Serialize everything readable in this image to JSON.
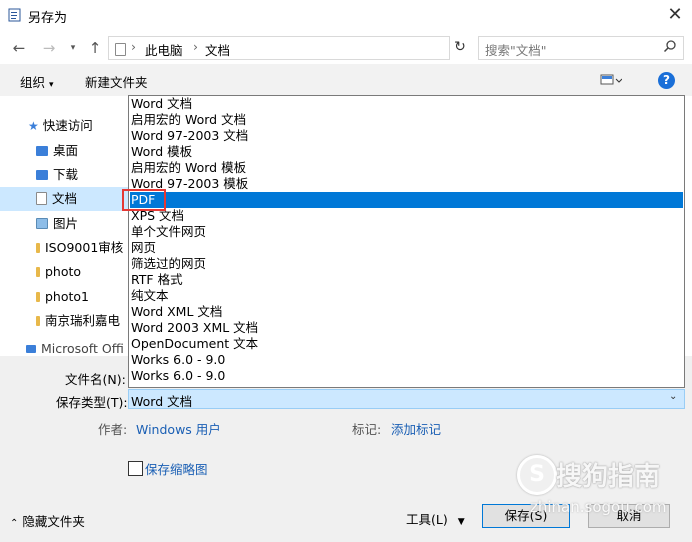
{
  "window": {
    "title": "另存为"
  },
  "nav": {
    "path": [
      "此电脑",
      "文档"
    ],
    "search_placeholder": "搜索\"文档\""
  },
  "toolbar": {
    "organize": "组织",
    "new_folder": "新建文件夹"
  },
  "sidebar": {
    "quick_access": "快速访问",
    "items": [
      "桌面",
      "下载",
      "文档",
      "图片",
      "ISO9001审核",
      "photo",
      "photo1",
      "南京瑞利嘉电",
      "Microsoft Offi"
    ]
  },
  "dropdown": {
    "options": [
      "Word 文档",
      "启用宏的 Word 文档",
      "Word 97-2003 文档",
      "Word 模板",
      "启用宏的 Word 模板",
      "Word 97-2003 模板",
      "PDF",
      "XPS 文档",
      "单个文件网页",
      "网页",
      "筛选过的网页",
      "RTF 格式",
      "纯文本",
      "Word XML 文档",
      "Word 2003 XML 文档",
      "OpenDocument 文本",
      "Works 6.0 - 9.0",
      "Works 6.0 - 9.0"
    ],
    "selected_index": 6
  },
  "form": {
    "filename_label": "文件名(N):",
    "type_label": "保存类型(T):",
    "type_value": "Word 文档",
    "author_label": "作者:",
    "author_value": "Windows 用户",
    "tags_label": "标记:",
    "tags_value": "添加标记",
    "thumbnail_label": "保存缩略图"
  },
  "footer": {
    "hide_folders": "隐藏文件夹",
    "tools": "工具(L)",
    "save": "保存(S)",
    "cancel": "取消"
  },
  "watermark": {
    "brand": "搜狗指南",
    "url": "zhinan.sogou.com"
  }
}
